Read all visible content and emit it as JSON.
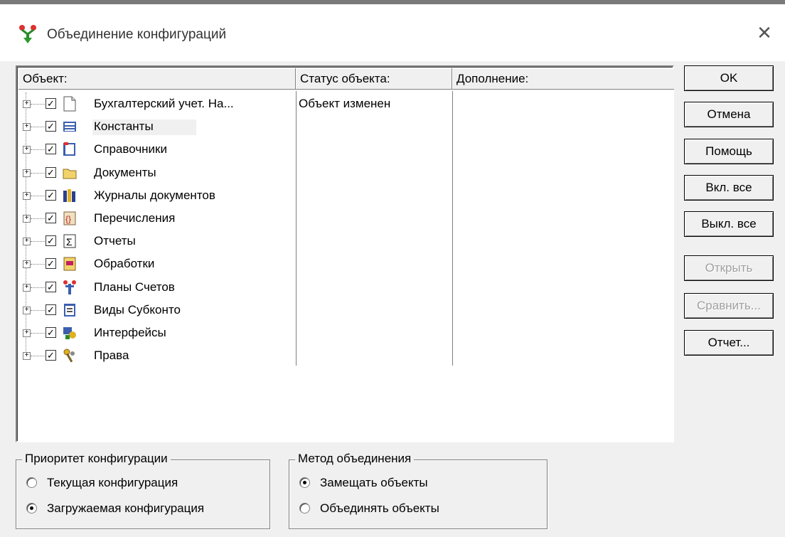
{
  "window": {
    "title": "Объединение конфигураций"
  },
  "list": {
    "columns": [
      "Объект:",
      "Статус объекта:",
      "Дополнение:"
    ],
    "items": [
      {
        "label": "Бухгалтерский учет. На...",
        "status": "Объект изменен",
        "icon": "document-icon",
        "checked": true
      },
      {
        "label": "Константы",
        "status": "",
        "icon": "constants-icon",
        "checked": true
      },
      {
        "label": "Справочники",
        "status": "",
        "icon": "catalogs-icon",
        "checked": true
      },
      {
        "label": "Документы",
        "status": "",
        "icon": "folder-icon",
        "checked": true
      },
      {
        "label": "Журналы документов",
        "status": "",
        "icon": "journals-icon",
        "checked": true
      },
      {
        "label": "Перечисления",
        "status": "",
        "icon": "enumerations-icon",
        "checked": true
      },
      {
        "label": "Отчеты",
        "status": "",
        "icon": "reports-icon",
        "checked": true
      },
      {
        "label": "Обработки",
        "status": "",
        "icon": "processing-icon",
        "checked": true
      },
      {
        "label": "Планы Счетов",
        "status": "",
        "icon": "chart-of-accounts-icon",
        "checked": true
      },
      {
        "label": "Виды Субконто",
        "status": "",
        "icon": "subconto-icon",
        "checked": true
      },
      {
        "label": "Интерфейсы",
        "status": "",
        "icon": "interfaces-icon",
        "checked": true
      },
      {
        "label": "Права",
        "status": "",
        "icon": "rights-icon",
        "checked": true
      }
    ]
  },
  "buttons": {
    "ok": "OK",
    "cancel": "Отмена",
    "help": "Помощь",
    "enable_all": "Вкл. все",
    "disable_all": "Выкл. все",
    "open": "Открыть",
    "compare": "Сравнить...",
    "report": "Отчет..."
  },
  "priority": {
    "legend": "Приоритет конфигурации",
    "options": [
      "Текущая конфигурация",
      "Загружаемая конфигурация"
    ],
    "selected": 1
  },
  "method": {
    "legend": "Метод объединения",
    "options": [
      "Замещать объекты",
      "Объединять объекты"
    ],
    "selected": 0
  }
}
